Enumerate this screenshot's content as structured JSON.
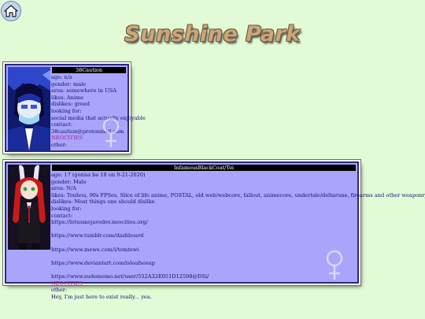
{
  "header": {
    "title": "Sunshine Park"
  },
  "nav": {
    "home_icon": "home-icon"
  },
  "profiles": [
    {
      "name": "38Caution",
      "lines": [
        "age: n/a",
        "gender: male",
        "area: somewhere in USA",
        "likes: Anime",
        "dislikes: greed",
        "looking for:",
        "social media that actually enjoyable",
        "contact:",
        "38caution@protonmail.com"
      ],
      "neocities": "NEOCITIES",
      "other": "other:",
      "gender_icon": "female-symbol-icon"
    },
    {
      "name": "InfamousBlackCoat/Tei",
      "lines": [
        "age: 17 (gonna be 18 on 9-21-2020)",
        "gender: Male",
        "area: N/A",
        "likes: Touhou, 90s FPSes, Slice of life anime, POSTAL, old web/webcore, fallout, animecore, undertale/deltarune, firearms and other weaponry",
        "dislikes: Most things one should dislike",
        "looking for:",
        "contact:",
        "https://lotusmojavedev.neocities.org/",
        "",
        "https://www.tumblr.com/dashboard",
        "",
        "https://www.mewe.com/i/tomtewi",
        "",
        "https://www.deviantart.com/isloafsosup",
        "",
        "https://www.sudomemo.net/user/552A32E051D12598@DSi/"
      ],
      "neocities": "NEOCITIES",
      "other": "other:",
      "other_text": "Hey, I'm just here to exist really... yea.",
      "gender_icon": "female-symbol-icon"
    }
  ],
  "colors": {
    "background": "#e2fbd6",
    "card": "#a9a5fb",
    "title": "#c9a77a",
    "link": "#a9218a"
  }
}
